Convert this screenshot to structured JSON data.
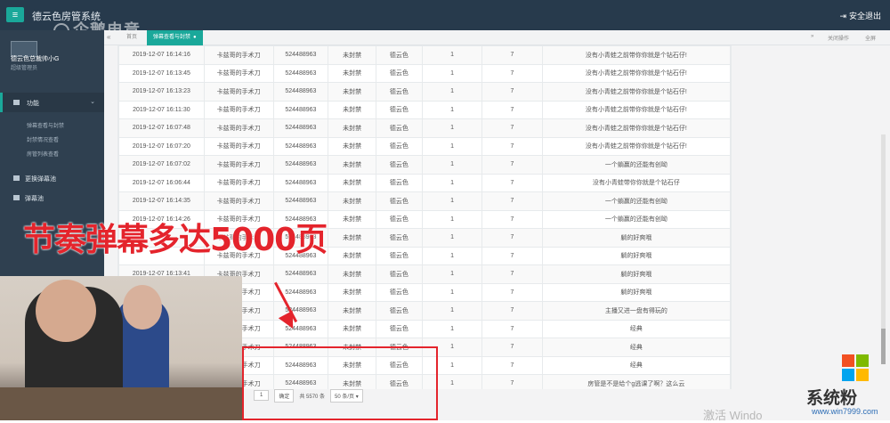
{
  "header": {
    "menu_icon": "hamburger-icon",
    "title": "德云色房管系统",
    "logout_label": "安全退出",
    "watermark": "企鹅电竞"
  },
  "sidebar": {
    "user_name": "德云色总裁帅小G",
    "user_role": "超级管理员",
    "active_label": "功能",
    "sub_items": [
      "弹幕查看与封禁",
      "封禁情况查看",
      "房管列表查看"
    ],
    "items": [
      "更换弹幕池",
      "弹幕池"
    ]
  },
  "tabs": {
    "back": "«",
    "home": "首页",
    "active": "弹幕查看与封禁",
    "close_icon": "close-icon",
    "forward": "»",
    "close_ops": "关闭操作",
    "fullscreen": "全屏"
  },
  "table": {
    "rows": [
      [
        "2019-12-07 16:14:16",
        "卡兹哥的手术刀",
        "524488963",
        "未封禁",
        "德云色",
        "1",
        "7",
        "没有小青蛙之前带你你就是个钻石仔!"
      ],
      [
        "2019-12-07 16:13:45",
        "卡兹哥的手术刀",
        "524488963",
        "未封禁",
        "德云色",
        "1",
        "7",
        "没有小青蛙之前带你你就是个钻石仔!"
      ],
      [
        "2019-12-07 16:13:23",
        "卡兹哥的手术刀",
        "524488963",
        "未封禁",
        "德云色",
        "1",
        "7",
        "没有小青蛙之前带你你就是个钻石仔!"
      ],
      [
        "2019-12-07 16:11:30",
        "卡兹哥的手术刀",
        "524488963",
        "未封禁",
        "德云色",
        "1",
        "7",
        "没有小青蛙之前带你你就是个钻石仔!"
      ],
      [
        "2019-12-07 16:07:48",
        "卡兹哥的手术刀",
        "524488963",
        "未封禁",
        "德云色",
        "1",
        "7",
        "没有小青蛙之前带你你就是个钻石仔!"
      ],
      [
        "2019-12-07 16:07:20",
        "卡兹哥的手术刀",
        "524488963",
        "未封禁",
        "德云色",
        "1",
        "7",
        "没有小青蛙之前带你你就是个钻石仔!"
      ],
      [
        "2019-12-07 16:07:02",
        "卡兹哥的手术刀",
        "524488963",
        "未封禁",
        "德云色",
        "1",
        "7",
        "一个躺赢的还能有创呦"
      ],
      [
        "2019-12-07 16:06:44",
        "卡兹哥的手术刀",
        "524488963",
        "未封禁",
        "德云色",
        "1",
        "7",
        "没有小青蛙带你你就是个钻石仔"
      ],
      [
        "2019-12-07 16:14:35",
        "卡兹哥的手术刀",
        "524488963",
        "未封禁",
        "德云色",
        "1",
        "7",
        "一个躺赢的还能有创呦"
      ],
      [
        "2019-12-07 16:14:26",
        "卡兹哥的手术刀",
        "524488963",
        "未封禁",
        "德云色",
        "1",
        "7",
        "一个躺赢的还能有创呦"
      ],
      [
        "",
        "卡兹哥的手术刀",
        "524488963",
        "未封禁",
        "德云色",
        "1",
        "7",
        "躺的好爽哦"
      ],
      [
        "",
        "卡兹哥的手术刀",
        "524488963",
        "未封禁",
        "德云色",
        "1",
        "7",
        "躺的好爽哦"
      ],
      [
        "2019-12-07 16:13:41",
        "卡兹哥的手术刀",
        "524488963",
        "未封禁",
        "德云色",
        "1",
        "7",
        "躺的好爽哦"
      ],
      [
        "",
        "卡兹哥的手术刀",
        "524488963",
        "未封禁",
        "德云色",
        "1",
        "7",
        "躺的好爽哦"
      ],
      [
        "",
        "卡兹哥的手术刀",
        "524488963",
        "未封禁",
        "德云色",
        "1",
        "7",
        "主播又进一盘有得玩的"
      ],
      [
        "",
        "卡兹哥的手术刀",
        "524488963",
        "未封禁",
        "德云色",
        "1",
        "7",
        "经典"
      ],
      [
        "",
        "卡兹哥的手术刀",
        "524488963",
        "未封禁",
        "德云色",
        "1",
        "7",
        "经典"
      ],
      [
        "",
        "卡兹哥的手术刀",
        "524488963",
        "未封禁",
        "德云色",
        "1",
        "7",
        "经典"
      ],
      [
        "",
        "卡兹哥的手术刀",
        "524488963",
        "未封禁",
        "德云色",
        "1",
        "7",
        "房管是不是给个g逃课了啊？这么云"
      ]
    ]
  },
  "pager": {
    "page_value": "1",
    "confirm": "确定",
    "total": "共 5570 条",
    "page_size": "50 条/页"
  },
  "overlay": {
    "caption": "节奏弹幕多达5000页",
    "activate_text": "激活 Windo",
    "brand": "系统粉",
    "url": "www.win7999.com",
    "colors": {
      "caption": "#e4242c",
      "accent": "#1aa89a",
      "sidebar": "#2f4050"
    }
  }
}
